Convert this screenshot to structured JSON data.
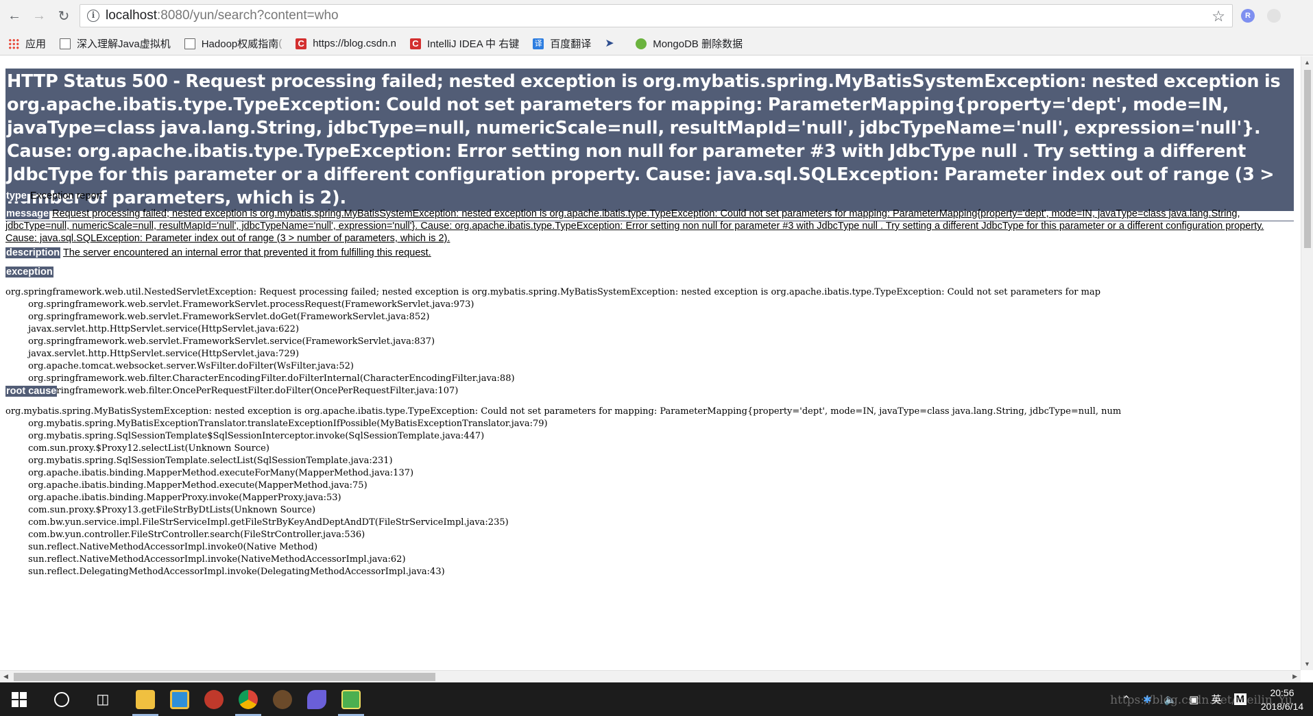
{
  "browser": {
    "url_host": "localhost",
    "url_rest": ":8080/yun/search?content=who",
    "ext_r_label": "R"
  },
  "bookmarks": [
    {
      "label": "应用",
      "dim": ""
    },
    {
      "label": "深入理解Java虚拟机",
      "dim": ""
    },
    {
      "label": "Hadoop权威指南",
      "dim": " ("
    },
    {
      "label": "https://blog.csdn.n",
      "dim": ""
    },
    {
      "label": "IntelliJ IDEA 中 右键",
      "dim": ""
    },
    {
      "label": "百度翻译",
      "dim": ""
    },
    {
      "label": "",
      "dim": ""
    },
    {
      "label": "MongoDB 删除数据",
      "dim": ""
    }
  ],
  "page": {
    "heading": "HTTP Status 500 - Request processing failed; nested exception is org.mybatis.spring.MyBatisSystemException: nested exception is org.apache.ibatis.type.TypeException: Could not set parameters for mapping: ParameterMapping{property='dept', mode=IN, javaType=class java.lang.String, jdbcType=null, numericScale=null, resultMapId='null', jdbcTypeName='null', expression='null'}. Cause: org.apache.ibatis.type.TypeException: Error setting non null for parameter #3 with JdbcType null . Try setting a different JdbcType for this parameter or a different configuration property. Cause: java.sql.SQLException: Parameter index out of range (3 > number of parameters, which is 2).",
    "type_label": "type",
    "type_value": "Exception report",
    "message_label": "message",
    "message_value": "Request processing failed; nested exception is org.mybatis.spring.MyBatisSystemException: nested exception is org.apache.ibatis.type.TypeException: Could not set parameters for mapping: ParameterMapping{property='dept', mode=IN, javaType=class java.lang.String, jdbcType=null, numericScale=null, resultMapId='null', jdbcTypeName='null', expression='null'}. Cause: org.apache.ibatis.type.TypeException: Error setting non null for parameter #3 with JdbcType null . Try setting a different JdbcType for this parameter or a different configuration property. Cause: java.sql.SQLException: Parameter index out of range (3 > number of parameters, which is 2).",
    "description_label": "description",
    "description_value": "The server encountered an internal error that prevented it from fulfilling this request.",
    "exception_label": "exception",
    "exception_trace": "org.springframework.web.util.NestedServletException: Request processing failed; nested exception is org.mybatis.spring.MyBatisSystemException: nested exception is org.apache.ibatis.type.TypeException: Could not set parameters for map\n\torg.springframework.web.servlet.FrameworkServlet.processRequest(FrameworkServlet.java:973)\n\torg.springframework.web.servlet.FrameworkServlet.doGet(FrameworkServlet.java:852)\n\tjavax.servlet.http.HttpServlet.service(HttpServlet.java:622)\n\torg.springframework.web.servlet.FrameworkServlet.service(FrameworkServlet.java:837)\n\tjavax.servlet.http.HttpServlet.service(HttpServlet.java:729)\n\torg.apache.tomcat.websocket.server.WsFilter.doFilter(WsFilter.java:52)\n\torg.springframework.web.filter.CharacterEncodingFilter.doFilterInternal(CharacterEncodingFilter.java:88)\n\torg.springframework.web.filter.OncePerRequestFilter.doFilter(OncePerRequestFilter.java:107)",
    "root_cause_label": "root cause",
    "root_cause_trace": "org.mybatis.spring.MyBatisSystemException: nested exception is org.apache.ibatis.type.TypeException: Could not set parameters for mapping: ParameterMapping{property='dept', mode=IN, javaType=class java.lang.String, jdbcType=null, num\n\torg.mybatis.spring.MyBatisExceptionTranslator.translateExceptionIfPossible(MyBatisExceptionTranslator.java:79)\n\torg.mybatis.spring.SqlSessionTemplate$SqlSessionInterceptor.invoke(SqlSessionTemplate.java:447)\n\tcom.sun.proxy.$Proxy12.selectList(Unknown Source)\n\torg.mybatis.spring.SqlSessionTemplate.selectList(SqlSessionTemplate.java:231)\n\torg.apache.ibatis.binding.MapperMethod.executeForMany(MapperMethod.java:137)\n\torg.apache.ibatis.binding.MapperMethod.execute(MapperMethod.java:75)\n\torg.apache.ibatis.binding.MapperProxy.invoke(MapperProxy.java:53)\n\tcom.sun.proxy.$Proxy13.getFileStrByDtLists(Unknown Source)\n\tcom.bw.yun.service.impl.FileStrServiceImpl.getFileStrByKeyAndDeptAndDT(FileStrServiceImpl.java:235)\n\tcom.bw.yun.controller.FileStrController.search(FileStrController.java:536)\n\tsun.reflect.NativeMethodAccessorImpl.invoke0(Native Method)\n\tsun.reflect.NativeMethodAccessorImpl.invoke(NativeMethodAccessorImpl.java:62)\n\tsun.reflect.DelegatingMethodAccessorImpl.invoke(DelegatingMethodAccessorImpl.java:43)"
  },
  "taskbar": {
    "tray_lang": "英",
    "tray_m": "M",
    "time": "20:56",
    "date": "2018/6/14",
    "watermark": "https://blog.csdn.net/meilin_Yu"
  },
  "colors": {
    "error_header_bg": "#525d76",
    "taskbar_bg": "#1c1c1c"
  }
}
